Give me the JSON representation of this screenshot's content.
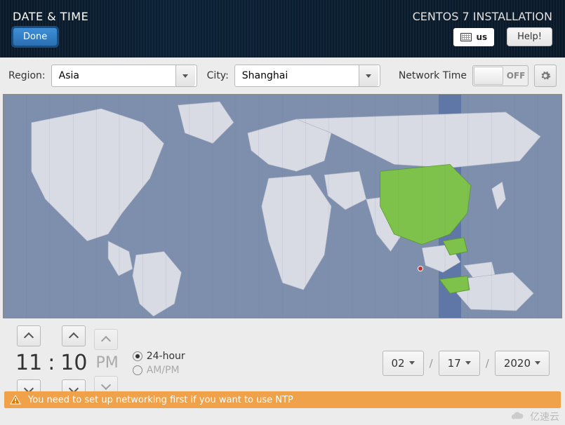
{
  "header": {
    "title": "DATE & TIME",
    "installer": "CENTOS 7 INSTALLATION",
    "done": "Done",
    "help": "Help!",
    "keyboard_layout": "us"
  },
  "selectors": {
    "region_label": "Region:",
    "region_value": "Asia",
    "city_label": "City:",
    "city_value": "Shanghai",
    "network_time_label": "Network Time",
    "network_time_state": "OFF"
  },
  "time": {
    "hour": "11",
    "colon": ":",
    "minute": "10",
    "ampm": "PM",
    "format_24_label": "24-hour",
    "format_ampm_label": "AM/PM",
    "selected_format": "24-hour"
  },
  "date": {
    "month": "02",
    "sep": "/",
    "day": "17",
    "year": "2020"
  },
  "warning": {
    "text": "You need to set up networking first if you want to use NTP"
  },
  "watermark": {
    "text": "亿速云"
  }
}
